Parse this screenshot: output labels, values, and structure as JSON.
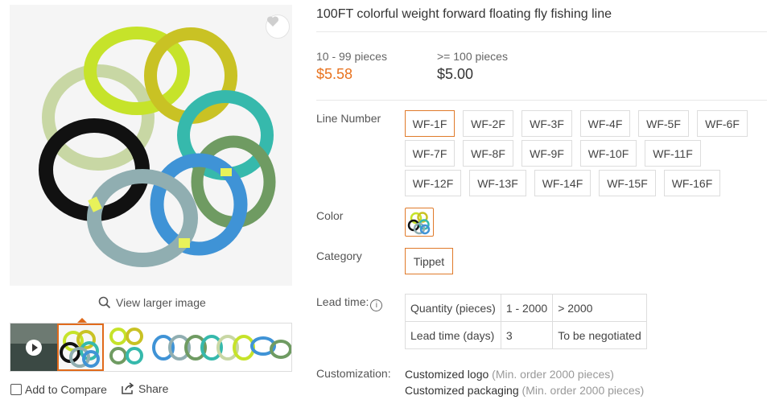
{
  "product": {
    "title": "100FT colorful weight forward floating fly fishing line"
  },
  "gallery": {
    "view_larger": "View larger image",
    "add_to_compare": "Add to Compare",
    "share": "Share",
    "favorite_icon": "heart-icon",
    "ring_colors": [
      "#c8d7a4",
      "#c6e32a",
      "#c9c224",
      "#111111",
      "#36b9ac",
      "#6f9b62",
      "#3f93d6",
      "#90aeb1"
    ]
  },
  "pricing": {
    "tiers": [
      {
        "range": "10 - 99 pieces",
        "price": "$5.58"
      },
      {
        "range": ">= 100 pieces",
        "price": "$5.00"
      }
    ],
    "accent_color": "#e8731f"
  },
  "options": {
    "line_number_label": "Line Number",
    "line_numbers": [
      "WF-1F",
      "WF-2F",
      "WF-3F",
      "WF-4F",
      "WF-5F",
      "WF-6F",
      "WF-7F",
      "WF-8F",
      "WF-9F",
      "WF-10F",
      "WF-11F",
      "WF-12F",
      "WF-13F",
      "WF-14F",
      "WF-15F",
      "WF-16F"
    ],
    "selected_line_number": "WF-1F",
    "color_label": "Color",
    "category_label": "Category",
    "category_value": "Tippet"
  },
  "lead_time": {
    "label": "Lead time:",
    "rows": [
      [
        "Quantity (pieces)",
        "1 - 2000",
        "> 2000"
      ],
      [
        "Lead time (days)",
        "3",
        "To be negotiated"
      ]
    ]
  },
  "customization": {
    "label": "Customization:",
    "items": [
      {
        "name": "Customized logo",
        "min": "(Min. order 2000 pieces)"
      },
      {
        "name": "Customized packaging",
        "min": "(Min. order 2000 pieces)"
      }
    ]
  }
}
